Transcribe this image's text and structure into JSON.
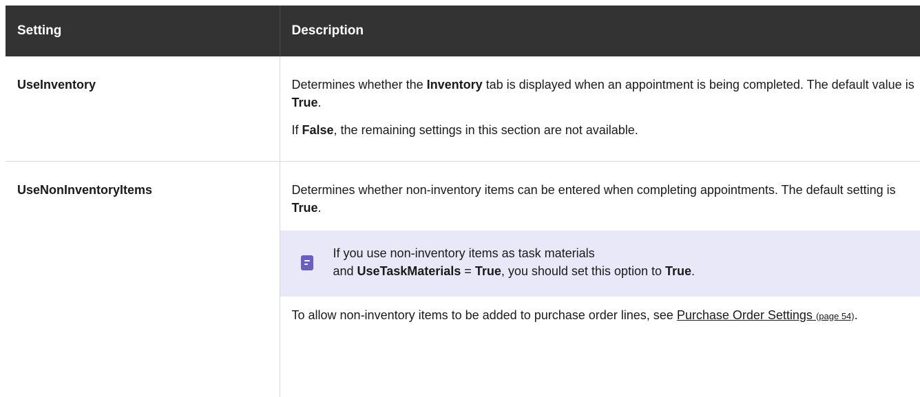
{
  "table": {
    "headers": {
      "setting": "Setting",
      "description": "Description"
    },
    "rows": [
      {
        "name": "UseInventory",
        "p1": {
          "t1": "Determines whether the ",
          "b1": "Inventory",
          "t2": " tab is displayed when an appointment is being completed. The default value is ",
          "b2": "True",
          "t3": "."
        },
        "p2": {
          "t1": "If ",
          "b1": "False",
          "t2": ", the remaining settings in this section are not available."
        }
      },
      {
        "name": "UseNonInventoryItems",
        "p1": {
          "t1": "Determines whether non-inventory items can be entered when completing appointments. The default setting is ",
          "b1": "True",
          "t2": "."
        },
        "note": {
          "icon": "note-icon",
          "line1": "If you use non-inventory items as task materials",
          "t1": "and ",
          "b1": "UseTaskMaterials",
          "t2": " = ",
          "b2": "True",
          "t3": ", you should set this option to ",
          "b3": "True",
          "t4": "."
        },
        "p2": {
          "t1": "To allow non-inventory items to be added to purchase order lines, see ",
          "link": "Purchase Order Settings",
          "page_ref": "(page 54)",
          "t2": "."
        }
      }
    ]
  },
  "colors": {
    "header_bg": "#333333",
    "header_text": "#ffffff",
    "note_bg": "#e8e8f8",
    "note_icon": "#6a5fc1"
  }
}
